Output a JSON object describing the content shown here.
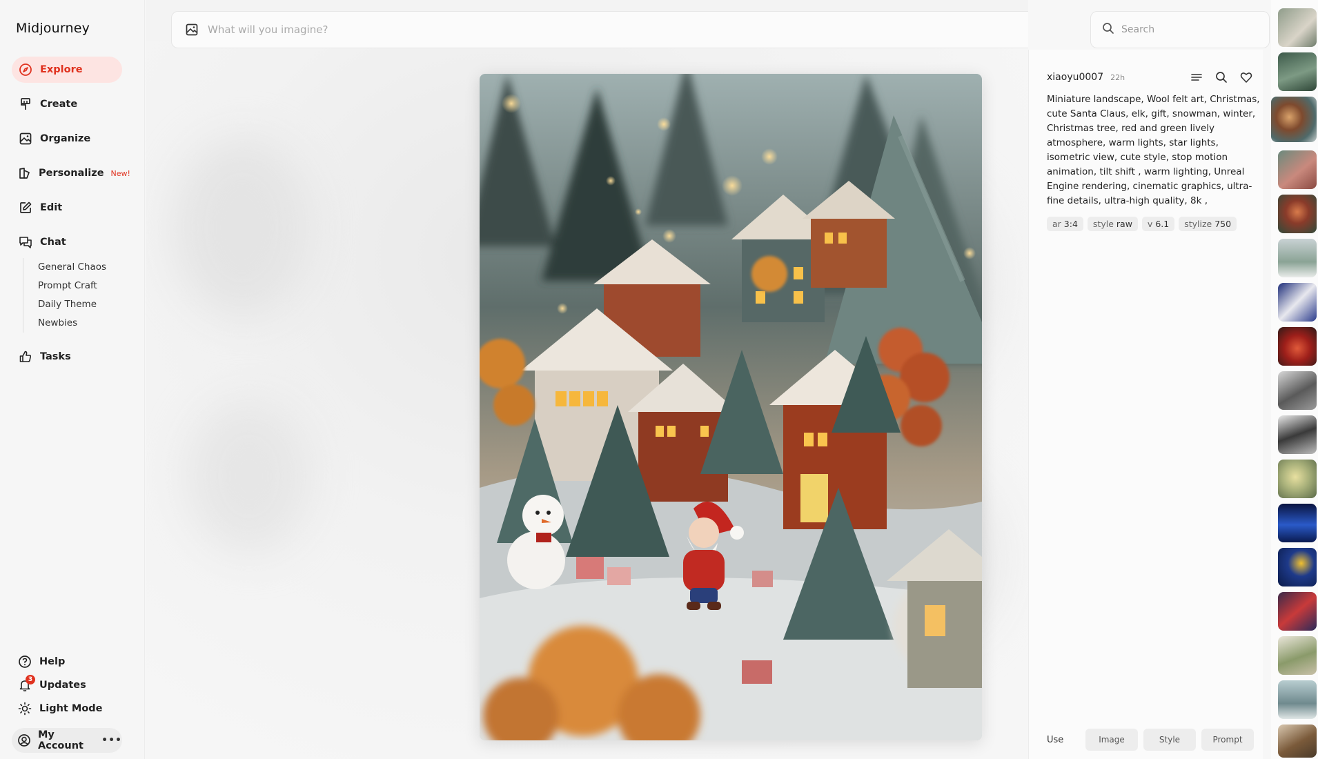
{
  "app": {
    "title": "Midjourney"
  },
  "sidebar": {
    "items": [
      {
        "label": "Explore",
        "icon": "compass-icon",
        "active": true
      },
      {
        "label": "Create",
        "icon": "brush-icon"
      },
      {
        "label": "Organize",
        "icon": "image-icon"
      },
      {
        "label": "Personalize",
        "icon": "personalize-icon",
        "badge": "New!"
      },
      {
        "label": "Edit",
        "icon": "pencil-square-icon"
      },
      {
        "label": "Chat",
        "icon": "chat-bubbles-icon"
      },
      {
        "label": "Tasks",
        "icon": "thumbs-up-icon"
      }
    ],
    "chat_rooms": [
      "General Chaos",
      "Prompt Craft",
      "Daily Theme",
      "Newbies"
    ],
    "help": "Help",
    "updates": "Updates",
    "updates_count": "3",
    "theme_toggle": "Light Mode",
    "account": "My Account"
  },
  "prompt_bar": {
    "placeholder": "What will you imagine?"
  },
  "search": {
    "placeholder": "Search"
  },
  "detail": {
    "author": "xiaoyu0007",
    "age": "22h",
    "prompt": "Miniature landscape, Wool felt art, Christmas, cute Santa Claus, elk, gift, snowman, winter, Christmas tree, red and green lively atmosphere, warm lights, star lights, isometric view, cute style, stop motion animation, tilt shift , warm lighting, Unreal Engine rendering, cinematic graphics, ultra-fine details, ultra-high quality, 8k ,",
    "params": [
      {
        "key": "ar",
        "value": "3:4"
      },
      {
        "key": "style",
        "value": "raw"
      },
      {
        "key": "v",
        "value": "6.1"
      },
      {
        "key": "stylize",
        "value": "750"
      }
    ],
    "use_label": "Use",
    "use_buttons": [
      "Image",
      "Style",
      "Prompt"
    ]
  },
  "colors": {
    "accent": "#e0321f",
    "active_bg": "#fde4e2"
  }
}
